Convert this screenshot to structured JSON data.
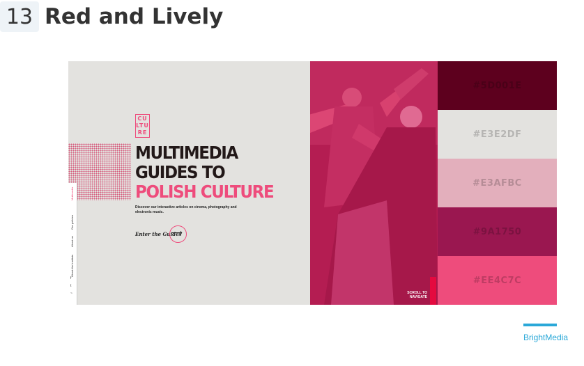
{
  "item": {
    "number": "13",
    "title": "Red and Lively"
  },
  "site": {
    "logo_text": "CULTURE.PL",
    "title_line1": "MULTIMEDIA",
    "title_line2": "GUIDES TO",
    "title_line3": "POLISH CULTURE",
    "description": "Discover our interactive articles on cinema, photography and electronic music.",
    "cta": "Enter the Guides",
    "scroll_hint": "SCROLL TO NAVIGATE",
    "nav": [
      "Multimedia",
      "Our policies",
      "About us",
      "About the Institute"
    ],
    "accent": "#EE4C7C"
  },
  "palette": [
    {
      "hex": "#5D001E",
      "label": "#5D001E"
    },
    {
      "hex": "#E3E2DF",
      "label": "#E3E2DF"
    },
    {
      "hex": "#E3AFBC",
      "label": "#E3AFBC"
    },
    {
      "hex": "#9A1750",
      "label": "#9A1750"
    },
    {
      "hex": "#EE4C7C",
      "label": "#EE4C7C"
    }
  ],
  "credit": {
    "label": "BrightMedia",
    "color": "#2AA8D8"
  }
}
